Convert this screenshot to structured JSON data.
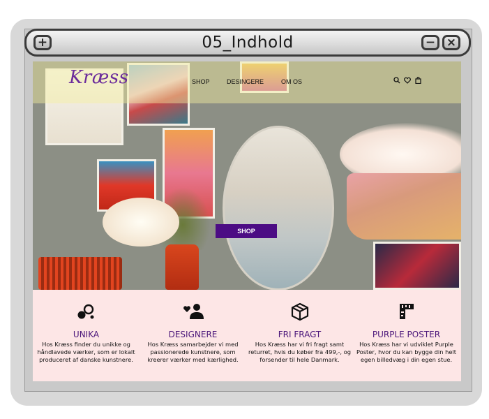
{
  "window": {
    "title": "05_Indhold"
  },
  "site": {
    "logo": "Kræss",
    "nav": [
      "SHOP",
      "DESINGERE",
      "OM OS"
    ],
    "hero_button": "SHOP",
    "features": [
      {
        "icon": "circles-icon",
        "title": "UNIKA",
        "text": "Hos Kræss finder du unikke og håndlavede værker, som er lokalt produceret af danske kunstnere."
      },
      {
        "icon": "people-heart-icon",
        "title": "DESIGNERE",
        "text": "Hos Kræss samarbejder vi med passionerede kunstnere, som kreerer værker med kærlighed."
      },
      {
        "icon": "box-icon",
        "title": "FRI FRAGT",
        "text": "Hos Kræss har vi fri fragt samt returret, hvis du køber fra 499,-, og forsender til hele Danmark."
      },
      {
        "icon": "ruler-icon",
        "title": "PURPLE POSTER",
        "text": "Hos Kræss har vi udviklet Purple Poster, hvor du kan bygge din helt egen billedvæg i din egen stue."
      }
    ]
  },
  "colors": {
    "accent": "#4c0c84",
    "background": "#fde6e6",
    "heading": "#4b167a"
  }
}
